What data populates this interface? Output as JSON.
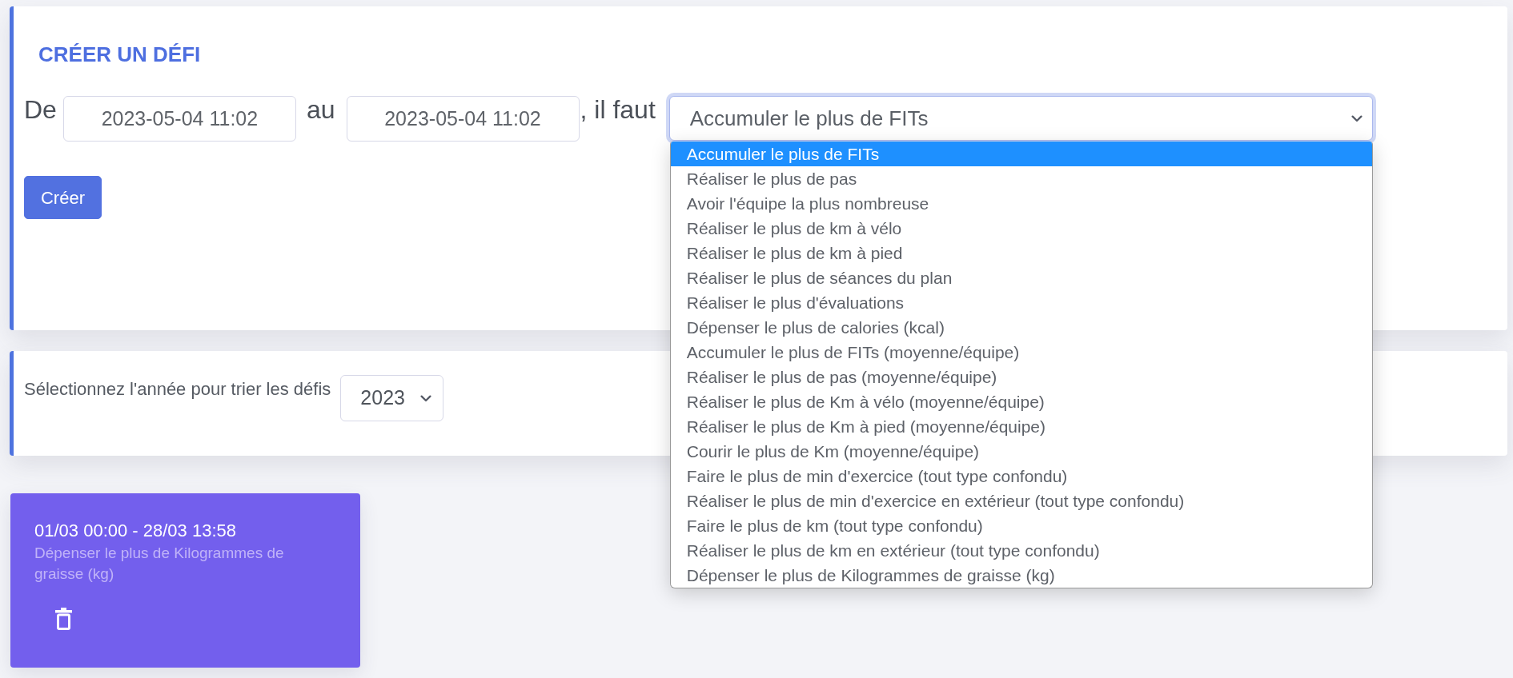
{
  "create_panel": {
    "title": "CRÉER UN DÉFI",
    "from_label": "De",
    "start_date": "2023-05-04 11:02",
    "to_label": "au",
    "end_date": "2023-05-04 11:02",
    "must_label": ", il faut",
    "goal_select": {
      "value": "Accumuler le plus de FITs",
      "expanded": true,
      "options": [
        {
          "label": "Accumuler le plus de FITs",
          "selected": true
        },
        {
          "label": "Réaliser le plus de pas",
          "selected": false
        },
        {
          "label": "Avoir l'équipe la plus nombreuse",
          "selected": false
        },
        {
          "label": "Réaliser le plus de km à vélo",
          "selected": false
        },
        {
          "label": "Réaliser le plus de km à pied",
          "selected": false
        },
        {
          "label": "Réaliser le plus de séances du plan",
          "selected": false
        },
        {
          "label": "Réaliser le plus d'évaluations",
          "selected": false
        },
        {
          "label": "Dépenser le plus de calories (kcal)",
          "selected": false
        },
        {
          "label": "Accumuler le plus de FITs (moyenne/équipe)",
          "selected": false
        },
        {
          "label": "Réaliser le plus de pas (moyenne/équipe)",
          "selected": false
        },
        {
          "label": "Réaliser le plus de Km à vélo (moyenne/équipe)",
          "selected": false
        },
        {
          "label": "Réaliser le plus de Km à pied (moyenne/équipe)",
          "selected": false
        },
        {
          "label": "Courir le plus de Km (moyenne/équipe)",
          "selected": false
        },
        {
          "label": "Faire le plus de min d'exercice (tout type confondu)",
          "selected": false
        },
        {
          "label": "Réaliser le plus de min d'exercice en extérieur (tout type confondu)",
          "selected": false
        },
        {
          "label": "Faire le plus de km (tout type confondu)",
          "selected": false
        },
        {
          "label": "Réaliser le plus de km en extérieur (tout type confondu)",
          "selected": false
        },
        {
          "label": "Dépenser le plus de Kilogrammes de graisse (kg)",
          "selected": false
        }
      ]
    },
    "create_button": "Créer"
  },
  "filter_panel": {
    "label": "Sélectionnez l'année pour trier les défis",
    "year_select": {
      "value": "2023"
    }
  },
  "challenges": [
    {
      "dates": "01/03 00:00 - 28/03 13:58",
      "goal": "Dépenser le plus de Kilogrammes de graisse (kg)"
    }
  ]
}
